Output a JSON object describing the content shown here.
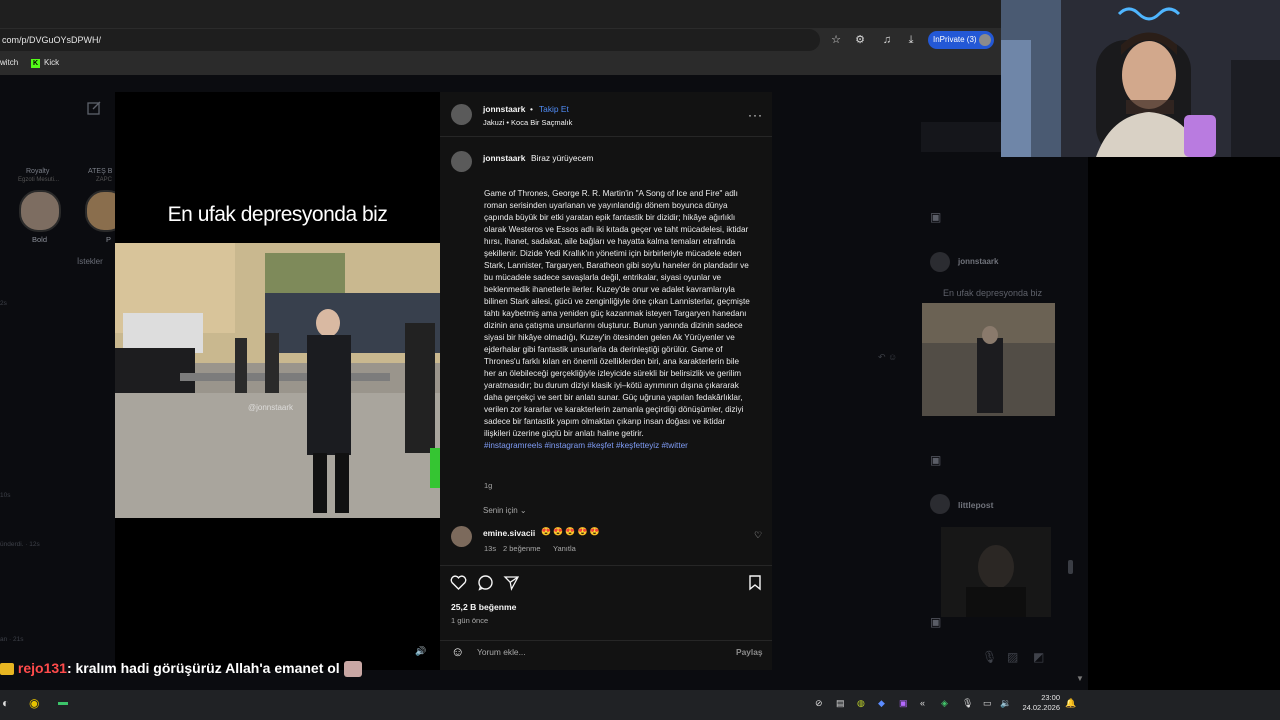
{
  "browser": {
    "url": "com/p/DVGuOYsDPWH/",
    "inprivate_label": "InPrivate (3)",
    "bookmarks": [
      {
        "label": "witch"
      },
      {
        "label": "Kick",
        "icon": "kick-logo"
      }
    ],
    "toolbar_icons": [
      "star-icon",
      "extensions-icon",
      "collections-icon",
      "download-icon"
    ]
  },
  "sidebar": {
    "stories": [
      {
        "label": "Bold",
        "top_label": "Royalty",
        "sub_label": "Egzoti Mesuti..."
      },
      {
        "label": "P",
        "top_label": "ATEŞ B",
        "sub_label": "ZAPC"
      }
    ],
    "requests_label": "İstekler",
    "times": [
      "2s",
      "10s",
      "ünderdi. · 12s",
      "an · 21s"
    ]
  },
  "reel": {
    "overlay_text": "En ufak depresyonda biz",
    "watermark": "@jonnstaark"
  },
  "post": {
    "username": "jonnstaark",
    "follow_label": "Takip Et",
    "subtitle": "Jakuzi • Koca Bir Saçmalık",
    "caption_user": "jonnstaark",
    "caption_title": "Biraz yürüyecem",
    "caption_body": "Game of Thrones, George R. R. Martin'in \"A Song of Ice and Fire\" adlı roman serisinden uyarlanan ve yayınlandığı dönem boyunca dünya çapında büyük bir etki yaratan epik fantastik bir dizidir; hikâye ağırlıklı olarak Westeros ve Essos adlı iki kıtada geçer ve taht mücadelesi, iktidar hırsı, ihanet, sadakat, aile bağları ve hayatta kalma temaları etrafında şekillenir. Dizide Yedi Krallık'ın yönetimi için birbirleriyle mücadele eden Stark, Lannister, Targaryen, Baratheon gibi soylu haneler ön plandadır ve bu mücadele sadece savaşlarla değil, entrikalar, siyasi oyunlar ve beklenmedik ihanetlerle ilerler. Kuzey'de onur ve adalet kavramlarıyla bilinen Stark ailesi, gücü ve zenginliğiyle öne çıkan Lannisterlar, geçmişte tahtı kaybetmiş ama yeniden güç kazanmak isteyen Targaryen hanedanı dizinin ana çatışma unsurlarını oluşturur. Bunun yanında dizinin sadece siyasi bir hikâye olmadığı, Kuzey'in ötesinden gelen Ak Yürüyenler ve ejderhalar gibi fantastik unsurlarla da derinleştiği görülür. Game of Thrones'u farklı kılan en önemli özelliklerden biri, ana karakterlerin bile her an ölebileceği gerçekliğiyle izleyicide sürekli bir belirsizlik ve gerilim yaratmasıdır; bu durum diziyi klasik iyi–kötü ayrımının dışına çıkararak daha gerçekçi ve sert bir anlatı sunar. Güç uğruna yapılan fedakârlıklar, verilen zor kararlar ve karakterlerin zamanla geçirdiği dönüşümler, diziyi sadece bir fantastik yapım olmaktan çıkarıp insan doğası ve iktidar ilişkileri üzerine güçlü bir anlatı haline getirir.",
    "hashtags": "#instagramreels #instagram #keşfet #keşfetteyiz #twitter",
    "caption_age": "1g",
    "for_you_label": "Senin için",
    "comment": {
      "user": "emine.sivacii",
      "text": "😍 😍 😍 😍 😍",
      "age": "13s",
      "likes": "2 beğenme",
      "reply_label": "Yanıtla"
    },
    "likes_label": "25,2 B beğenme",
    "date_label": "1 gün önce",
    "comment_placeholder": "Yorum ekle...",
    "share_label": "Paylaş"
  },
  "right_pane": {
    "user": "jonnstaark",
    "caption": "En ufak depresyonda biz",
    "second_user": "littlepost"
  },
  "chat": {
    "username": "rejo131",
    "message": ": kralım hadi görüşürüz Allah'a emanet ol"
  },
  "taskbar": {
    "time": "23:00",
    "date": "24.02.2026"
  }
}
